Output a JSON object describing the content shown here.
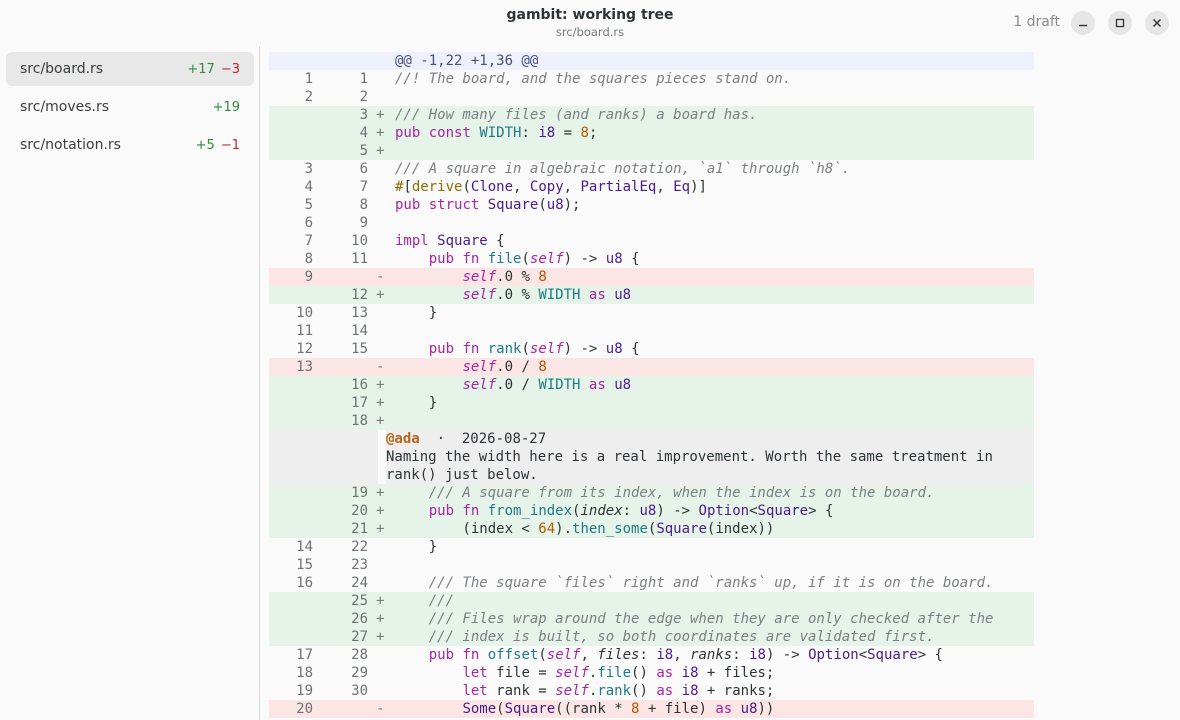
{
  "window": {
    "title": "gambit: working tree",
    "subtitle": "src/board.rs",
    "draft_badge": "1 draft",
    "controls": [
      "minimize-icon",
      "maximize-icon",
      "close-icon"
    ]
  },
  "sidebar": {
    "files": [
      {
        "name": "src/board.rs",
        "added": "+17",
        "removed": "−3",
        "active": true
      },
      {
        "name": "src/moves.rs",
        "added": "+19",
        "removed": "",
        "active": false
      },
      {
        "name": "src/notation.rs",
        "added": "+5",
        "removed": "−1",
        "active": false
      }
    ]
  },
  "diff": {
    "lines": [
      {
        "kind": "hunk",
        "old": "",
        "new": "",
        "mark": "",
        "code": "@@ -1,22 +1,36 @@"
      },
      {
        "kind": "ctx",
        "old": "1",
        "new": "1",
        "mark": "",
        "code": "//! The board, and the squares pieces stand on."
      },
      {
        "kind": "ctx",
        "old": "2",
        "new": "2",
        "mark": "",
        "code": ""
      },
      {
        "kind": "add",
        "old": "",
        "new": "3",
        "mark": "+",
        "code": "/// How many files (and ranks) a board has."
      },
      {
        "kind": "add",
        "old": "",
        "new": "4",
        "mark": "+",
        "code": "pub const WIDTH: i8 = 8;"
      },
      {
        "kind": "add",
        "old": "",
        "new": "5",
        "mark": "+",
        "code": ""
      },
      {
        "kind": "ctx",
        "old": "3",
        "new": "6",
        "mark": "",
        "code": "/// A square in algebraic notation, `a1` through `h8`."
      },
      {
        "kind": "ctx",
        "old": "4",
        "new": "7",
        "mark": "",
        "code": "#[derive(Clone, Copy, PartialEq, Eq)]"
      },
      {
        "kind": "ctx",
        "old": "5",
        "new": "8",
        "mark": "",
        "code": "pub struct Square(u8);"
      },
      {
        "kind": "ctx",
        "old": "6",
        "new": "9",
        "mark": "",
        "code": ""
      },
      {
        "kind": "ctx",
        "old": "7",
        "new": "10",
        "mark": "",
        "code": "impl Square {"
      },
      {
        "kind": "ctx",
        "old": "8",
        "new": "11",
        "mark": "",
        "code": "    pub fn file(self) -> u8 {"
      },
      {
        "kind": "del",
        "old": "9",
        "new": "",
        "mark": "-",
        "code": "        self.0 % 8"
      },
      {
        "kind": "add",
        "old": "",
        "new": "12",
        "mark": "+",
        "code": "        self.0 % WIDTH as u8"
      },
      {
        "kind": "ctx",
        "old": "10",
        "new": "13",
        "mark": "",
        "code": "    }"
      },
      {
        "kind": "ctx",
        "old": "11",
        "new": "14",
        "mark": "",
        "code": ""
      },
      {
        "kind": "ctx",
        "old": "12",
        "new": "15",
        "mark": "",
        "code": "    pub fn rank(self) -> u8 {"
      },
      {
        "kind": "del",
        "old": "13",
        "new": "",
        "mark": "-",
        "code": "        self.0 / 8"
      },
      {
        "kind": "add",
        "old": "",
        "new": "16",
        "mark": "+",
        "code": "        self.0 / WIDTH as u8"
      },
      {
        "kind": "add",
        "old": "",
        "new": "17",
        "mark": "+",
        "code": "    }"
      },
      {
        "kind": "add",
        "old": "",
        "new": "18",
        "mark": "+",
        "code": ""
      }
    ],
    "comment": {
      "author": "@ada",
      "separator": "·",
      "date": "2026-08-27",
      "text_line1": "Naming the width here is a real improvement. Worth the same treatment in",
      "text_line2": "rank() just below."
    },
    "lines2": [
      {
        "kind": "add",
        "old": "",
        "new": "19",
        "mark": "+",
        "code": "    /// A square from its index, when the index is on the board."
      },
      {
        "kind": "add",
        "old": "",
        "new": "20",
        "mark": "+",
        "code": "    pub fn from_index(index: u8) -> Option<Square> {"
      },
      {
        "kind": "add",
        "old": "",
        "new": "21",
        "mark": "+",
        "code": "        (index < 64).then_some(Square(index))"
      },
      {
        "kind": "ctx",
        "old": "14",
        "new": "22",
        "mark": "",
        "code": "    }"
      },
      {
        "kind": "ctx",
        "old": "15",
        "new": "23",
        "mark": "",
        "code": ""
      },
      {
        "kind": "ctx",
        "old": "16",
        "new": "24",
        "mark": "",
        "code": "    /// The square `files` right and `ranks` up, if it is on the board."
      },
      {
        "kind": "add",
        "old": "",
        "new": "25",
        "mark": "+",
        "code": "    ///"
      },
      {
        "kind": "add",
        "old": "",
        "new": "26",
        "mark": "+",
        "code": "    /// Files wrap around the edge when they are only checked after the"
      },
      {
        "kind": "add",
        "old": "",
        "new": "27",
        "mark": "+",
        "code": "    /// index is built, so both coordinates are validated first."
      },
      {
        "kind": "ctx",
        "old": "17",
        "new": "28",
        "mark": "",
        "code": "    pub fn offset(self, files: i8, ranks: i8) -> Option<Square> {"
      },
      {
        "kind": "ctx",
        "old": "18",
        "new": "29",
        "mark": "",
        "code": "        let file = self.file() as i8 + files;"
      },
      {
        "kind": "ctx",
        "old": "19",
        "new": "30",
        "mark": "",
        "code": "        let rank = self.rank() as i8 + ranks;"
      },
      {
        "kind": "del",
        "old": "20",
        "new": "",
        "mark": "-",
        "code": "        Some(Square((rank * 8 + file) as u8))"
      }
    ]
  },
  "colors": {
    "add_bg": "#e5f3e8",
    "del_bg": "#fbe5e5",
    "hunk_bg": "#eef1fb",
    "added_text": "#2f8a3e",
    "removed_text": "#c0262d",
    "author": "#b5651d"
  }
}
